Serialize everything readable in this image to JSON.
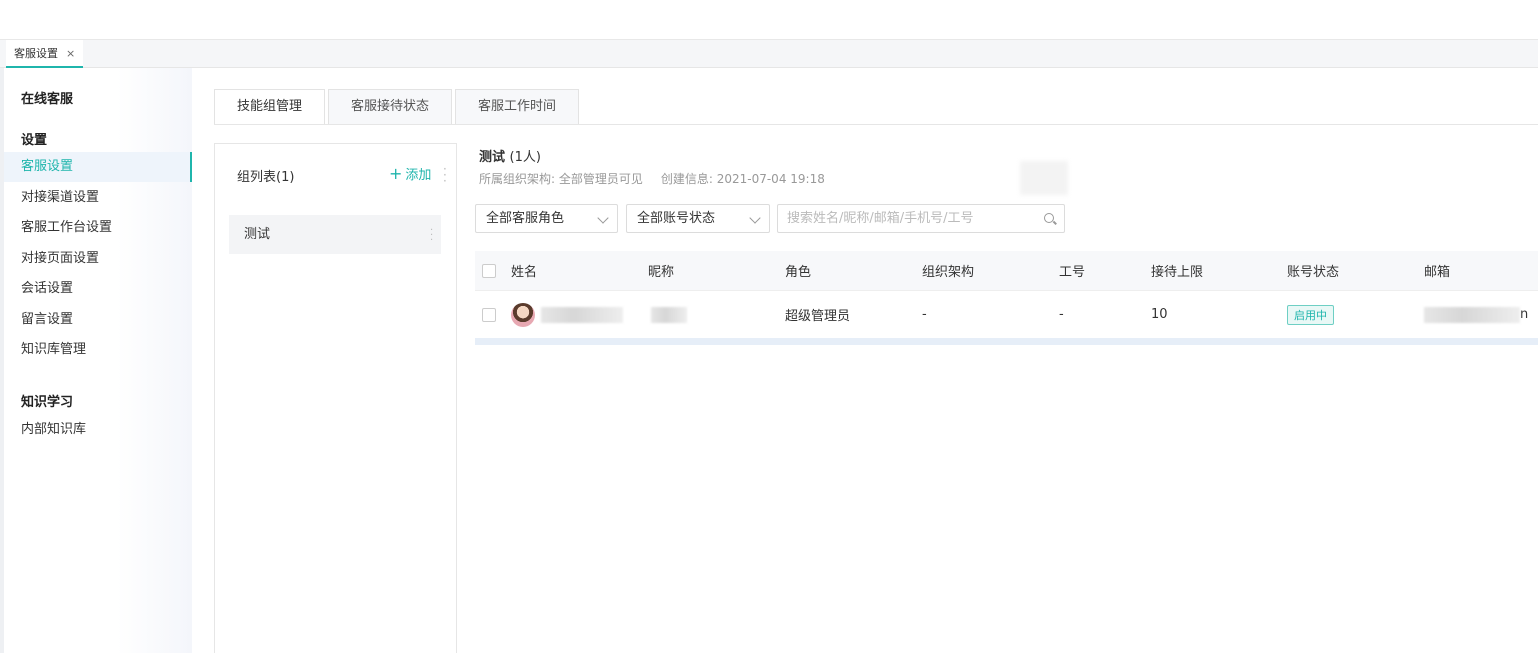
{
  "page_tab": {
    "label": "客服设置",
    "close": "×"
  },
  "sidebar": {
    "section1": "在线客服",
    "section2": "设置",
    "items": [
      {
        "label": "客服设置",
        "active": true
      },
      {
        "label": "对接渠道设置"
      },
      {
        "label": "客服工作台设置"
      },
      {
        "label": "对接页面设置"
      },
      {
        "label": "会话设置"
      },
      {
        "label": "留言设置"
      },
      {
        "label": "知识库管理"
      }
    ],
    "section3": "知识学习",
    "items2": [
      {
        "label": "内部知识库"
      }
    ]
  },
  "tabs": [
    {
      "label": "技能组管理",
      "active": true
    },
    {
      "label": "客服接待状态"
    },
    {
      "label": "客服工作时间"
    }
  ],
  "group_panel": {
    "title": "组列表(1)",
    "add_label": "添加",
    "groups": [
      {
        "name": "测试"
      }
    ]
  },
  "detail": {
    "title": "测试",
    "count": "(1人)",
    "org_label": "所属组织架构: 全部管理员可见",
    "created_label": "创建信息: 2021-07-04 19:18"
  },
  "filters": {
    "role_select": "全部客服角色",
    "status_select": "全部账号状态",
    "search_placeholder": "搜索姓名/昵称/邮箱/手机号/工号"
  },
  "table": {
    "columns": [
      "姓名",
      "昵称",
      "角色",
      "组织架构",
      "工号",
      "接待上限",
      "账号状态",
      "邮箱"
    ],
    "rows": [
      {
        "role": "超级管理员",
        "org": "-",
        "job_no": "-",
        "limit": "10",
        "status": "启用中",
        "email_tail": "n"
      }
    ]
  },
  "colors": {
    "accent": "#1fb5ac"
  }
}
